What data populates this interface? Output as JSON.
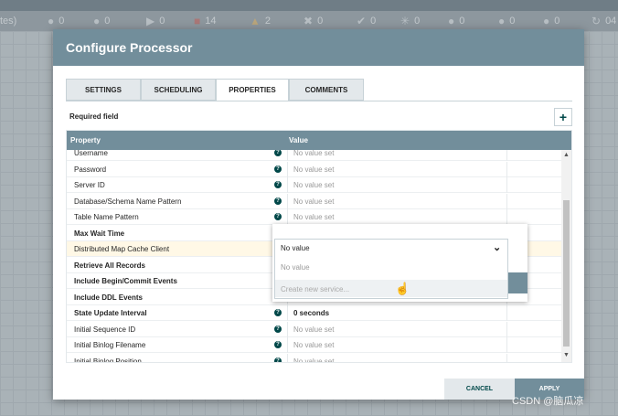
{
  "statusbar": {
    "lead": "tes)",
    "stats": [
      {
        "icon": "transmitting-icon",
        "glyph": "●",
        "value": "0"
      },
      {
        "icon": "not-transmitting-icon",
        "glyph": "●",
        "value": "0"
      },
      {
        "icon": "running-icon",
        "glyph": "▶",
        "value": "0"
      },
      {
        "icon": "stopped-icon",
        "glyph": "■",
        "value": "14"
      },
      {
        "icon": "invalid-icon",
        "glyph": "▲",
        "value": "2"
      },
      {
        "icon": "disabled-icon",
        "glyph": "✖",
        "value": "0"
      },
      {
        "icon": "up-to-date-icon",
        "glyph": "✔",
        "value": "0"
      },
      {
        "icon": "locally-modified-icon",
        "glyph": "✳",
        "value": "0"
      },
      {
        "icon": "stale-icon",
        "glyph": "●",
        "value": "0"
      },
      {
        "icon": "sync-failure-icon",
        "glyph": "●",
        "value": "0"
      },
      {
        "icon": "errors-icon",
        "glyph": "●",
        "value": "0"
      },
      {
        "icon": "refresh-icon",
        "glyph": "↻",
        "value": "04"
      }
    ]
  },
  "dialog": {
    "title": "Configure Processor",
    "tabs": [
      {
        "label": "SETTINGS",
        "active": false
      },
      {
        "label": "SCHEDULING",
        "active": false
      },
      {
        "label": "PROPERTIES",
        "active": true
      },
      {
        "label": "COMMENTS",
        "active": false
      }
    ],
    "required_label": "Required field",
    "add_button": "+",
    "table": {
      "col_property": "Property",
      "col_value": "Value",
      "rows": [
        {
          "name": "Username",
          "bold": false,
          "value": "No value set",
          "set": false,
          "help": true
        },
        {
          "name": "Password",
          "bold": false,
          "value": "No value set",
          "set": false,
          "help": true
        },
        {
          "name": "Server ID",
          "bold": false,
          "value": "No value set",
          "set": false,
          "help": true
        },
        {
          "name": "Database/Schema Name Pattern",
          "bold": false,
          "value": "No value set",
          "set": false,
          "help": true
        },
        {
          "name": "Table Name Pattern",
          "bold": false,
          "value": "No value set",
          "set": false,
          "help": true
        },
        {
          "name": "Max Wait Time",
          "bold": true,
          "value": "",
          "set": false,
          "help": false
        },
        {
          "name": "Distributed Map Cache Client",
          "bold": false,
          "value": "",
          "set": false,
          "help": false,
          "highlight": true
        },
        {
          "name": "Retrieve All Records",
          "bold": true,
          "value": "",
          "set": false,
          "help": false
        },
        {
          "name": "Include Begin/Commit Events",
          "bold": true,
          "value": "",
          "set": false,
          "help": false
        },
        {
          "name": "Include DDL Events",
          "bold": true,
          "value": "",
          "set": false,
          "help": true
        },
        {
          "name": "State Update Interval",
          "bold": true,
          "value": "0 seconds",
          "set": true,
          "help": true
        },
        {
          "name": "Initial Sequence ID",
          "bold": false,
          "value": "No value set",
          "set": false,
          "help": true
        },
        {
          "name": "Initial Binlog Filename",
          "bold": false,
          "value": "No value set",
          "set": false,
          "help": true
        },
        {
          "name": "Initial Binlog Position",
          "bold": false,
          "value": "No value set",
          "set": false,
          "help": true
        }
      ]
    },
    "dropdown": {
      "selected": "No value",
      "options": [
        "No value",
        "Create new service..."
      ]
    },
    "cancel_label": "CANCEL",
    "apply_label": "APPLY"
  },
  "watermark": "CSDN @脑瓜凉"
}
